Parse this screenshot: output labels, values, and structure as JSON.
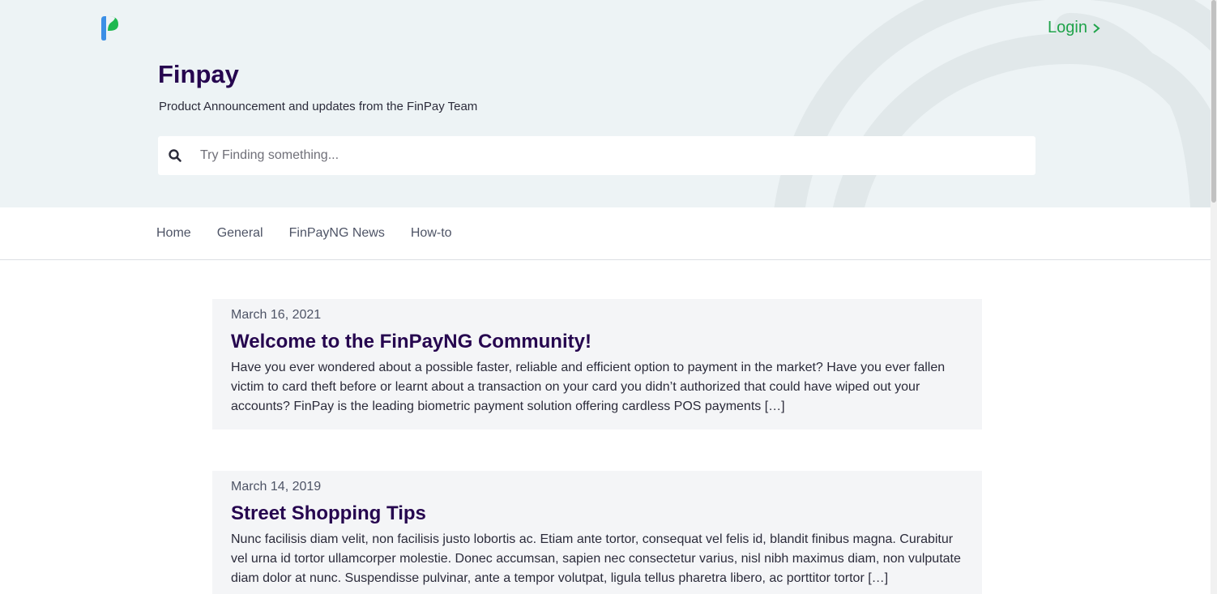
{
  "header": {
    "logo_icon": "finpay-logo-icon",
    "login_label": "Login",
    "login_icon": "chevron-right-icon",
    "title": "Finpay",
    "subtitle": "Product Announcement and updates from the FinPay Team"
  },
  "search": {
    "icon": "search-icon",
    "placeholder": "Try Finding something...",
    "value": ""
  },
  "nav": {
    "items": [
      {
        "label": "Home"
      },
      {
        "label": "General"
      },
      {
        "label": "FinPayNG News"
      },
      {
        "label": "How-to"
      }
    ]
  },
  "posts": [
    {
      "date": "March 16, 2021",
      "title": "Welcome to the FinPayNG Community!",
      "excerpt": "Have you ever wondered about a possible faster, reliable and efficient option to payment in the market? Have you ever fallen victim to card theft before or learnt about a transaction on your card you didn’t authorized that could have wiped out your accounts? FinPay is the leading biometric payment solution offering cardless POS payments […]"
    },
    {
      "date": "March 14, 2019",
      "title": "Street Shopping Tips",
      "excerpt": "Nunc facilisis diam velit, non facilisis justo lobortis ac. Etiam ante tortor, consequat vel felis id, blandit finibus magna. Curabitur vel urna id tortor ullamcorper molestie. Donec accumsan, sapien nec consectetur varius, nisl nibh maximus diam, non vulputate diam dolor at nunc. Suspendisse pulvinar, ante a tempor volutpat, ligula tellus pharetra libero, ac porttitor tortor […]"
    }
  ],
  "colors": {
    "hero_bg": "#edf3f5",
    "title": "#26064f",
    "login": "#1fa34a",
    "card_bg": "#f4f5f7"
  }
}
